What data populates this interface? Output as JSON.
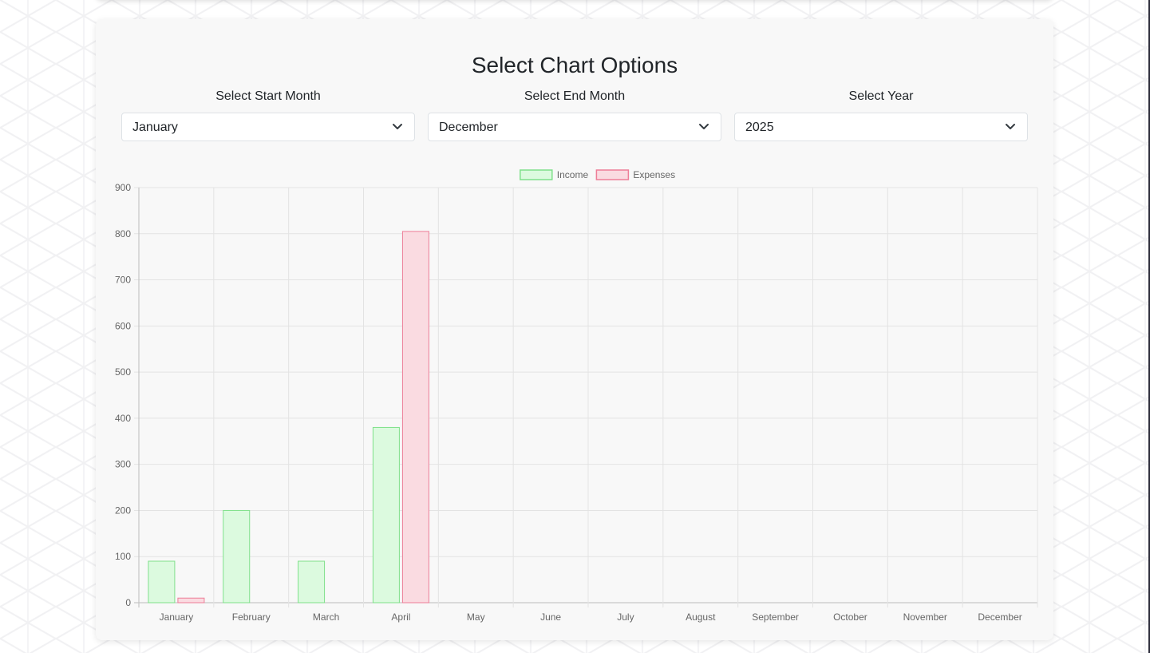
{
  "options": {
    "title": "Select Chart Options",
    "start_month": {
      "label": "Select Start Month",
      "value": "January"
    },
    "end_month": {
      "label": "Select End Month",
      "value": "December"
    },
    "year": {
      "label": "Select Year",
      "value": "2025"
    }
  },
  "chart_data": {
    "type": "bar",
    "categories": [
      "January",
      "February",
      "March",
      "April",
      "May",
      "June",
      "July",
      "August",
      "September",
      "October",
      "November",
      "December"
    ],
    "series": [
      {
        "name": "Income",
        "values": [
          90,
          200,
          90,
          380,
          0,
          0,
          0,
          0,
          0,
          0,
          0,
          0
        ],
        "fill": "#dcfadf",
        "stroke": "#7fe08a"
      },
      {
        "name": "Expenses",
        "values": [
          10,
          0,
          0,
          805,
          0,
          0,
          0,
          0,
          0,
          0,
          0,
          0
        ],
        "fill": "#fadbe1",
        "stroke": "#ee7e98"
      }
    ],
    "ylim": [
      0,
      900
    ],
    "yticks": [
      0,
      100,
      200,
      300,
      400,
      500,
      600,
      700,
      800,
      900
    ],
    "legend": "top-center",
    "grid": true
  }
}
